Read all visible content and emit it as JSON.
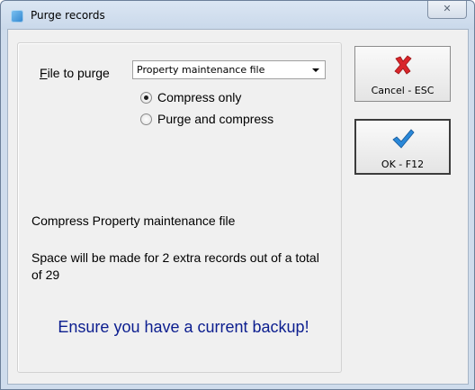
{
  "window": {
    "title": "Purge records",
    "close_glyph": "✕"
  },
  "form": {
    "file_label_accel": "F",
    "file_label_rest": "ile to purge",
    "file_selected": "Property maintenance file",
    "options": [
      {
        "label": "Compress only",
        "checked": true
      },
      {
        "label": "Purge and compress",
        "checked": false
      }
    ]
  },
  "info": {
    "action": "Compress Property maintenance file",
    "space": "Space will be made for 2 extra records out of a total of 29",
    "warning": "Ensure you have a current backup!"
  },
  "buttons": {
    "cancel_label": "Cancel - ESC",
    "ok_label": "OK - F12"
  },
  "colors": {
    "warning_text": "#0c1e8f",
    "cancel_icon": "#d9262b",
    "ok_icon": "#2a88d8"
  }
}
